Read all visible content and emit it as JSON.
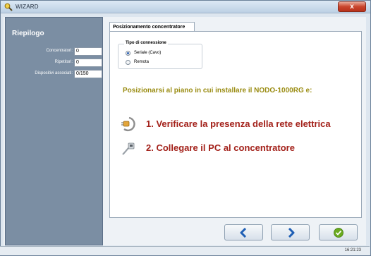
{
  "window": {
    "title": "WIZARD",
    "close_label": "x"
  },
  "sidebar": {
    "title": "Riepilogo",
    "rows": [
      {
        "label": "Concentratori:",
        "value": "0"
      },
      {
        "label": "Ripetitori:",
        "value": "0"
      },
      {
        "label": "Dispositivi associati:",
        "value": "0/150"
      }
    ]
  },
  "tab": {
    "label": "Posizionamento concentratore"
  },
  "connection": {
    "legend": "Tipo di connessione",
    "options": [
      {
        "label": "Seriale (Cavo)",
        "selected": true
      },
      {
        "label": "Remota",
        "selected": false
      }
    ]
  },
  "instruction": "Posizionarsi al piano in cui installare il NODO-1000RG e:",
  "steps": [
    {
      "text": "1. Verificare la presenza della rete elettrica",
      "icon": "power-plug-icon"
    },
    {
      "text": "2. Collegare il PC al concentratore",
      "icon": "network-cable-icon"
    }
  ],
  "buttons": {
    "back": {
      "icon": "chevron-left-icon"
    },
    "next": {
      "icon": "chevron-right-icon"
    },
    "finish": {
      "icon": "check-circle-icon"
    }
  },
  "status": {
    "time": "16:21:23"
  },
  "colors": {
    "accent": "#2a5db0",
    "instruction": "#9a8c12",
    "steps": "#a3211a",
    "sidebar": "#7b8ea3",
    "finish": "#6aaa1e"
  }
}
